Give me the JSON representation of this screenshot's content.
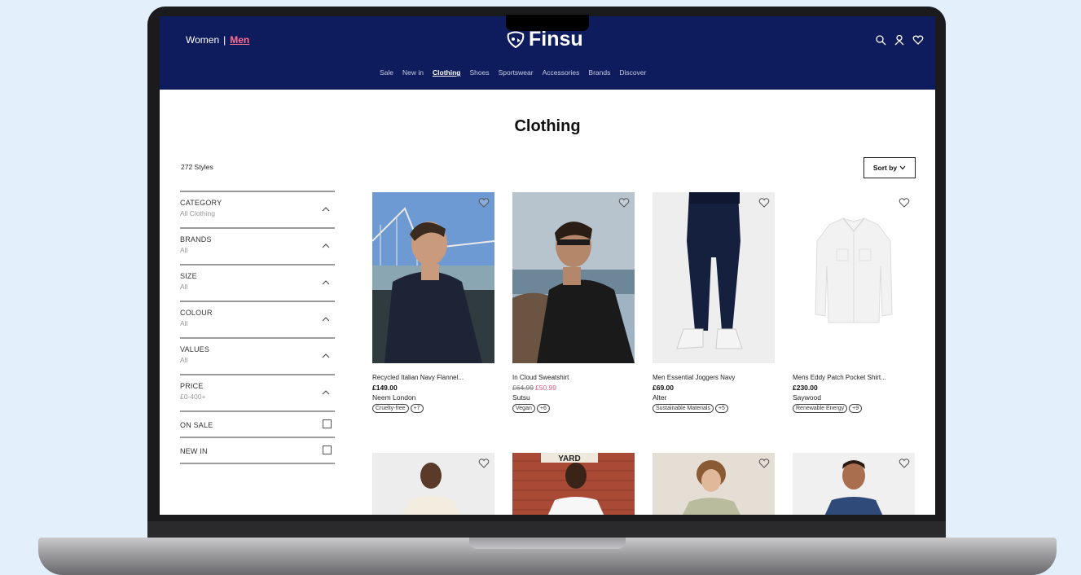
{
  "header": {
    "gender_women": "Women",
    "gender_separator": "|",
    "gender_men": "Men",
    "logo_text": "Finsu",
    "nav": [
      "Sale",
      "New in",
      "Clothing",
      "Shoes",
      "Sportswear",
      "Accessories",
      "Brands",
      "Discover"
    ],
    "active_nav": "Clothing"
  },
  "page": {
    "title": "Clothing",
    "styles_count": "272 Styles",
    "sort_label": "Sort by"
  },
  "filters": [
    {
      "title": "CATEGORY",
      "value": "All Clothing"
    },
    {
      "title": "BRANDS",
      "value": "All"
    },
    {
      "title": "SIZE",
      "value": "All"
    },
    {
      "title": "COLOUR",
      "value": "All"
    },
    {
      "title": "VALUES",
      "value": "All"
    },
    {
      "title": "PRICE",
      "value": "£0-400+"
    }
  ],
  "toggles": [
    {
      "title": "ON SALE"
    },
    {
      "title": "NEW IN"
    }
  ],
  "products": [
    {
      "name": "Recycled Italian Navy Flannel...",
      "price": "£149.00",
      "brand": "Neem London",
      "tags": [
        "Cruelty-free",
        "+7"
      ]
    },
    {
      "name": "In Cloud Sweatshirt",
      "old_price": "£64.99",
      "sale_price": "£50.99",
      "brand": "Sutsu",
      "tags": [
        "Vegan",
        "+6"
      ]
    },
    {
      "name": "Men Essential Joggers Navy",
      "price": "£69.00",
      "brand": "Alter",
      "tags": [
        "Sustainable Materials",
        "+5"
      ]
    },
    {
      "name": "Mens Eddy Patch Pocket Shirt...",
      "price": "£230.00",
      "brand": "Saywood",
      "tags": [
        "Renewable Energy",
        "+9"
      ]
    }
  ],
  "row2_sign_text": "YARD",
  "colors": {
    "header_bg": "#0e1c5d",
    "accent_pink": "#ff6f91",
    "sale_red": "#e55a7f",
    "page_bg": "#e3f0fb"
  }
}
